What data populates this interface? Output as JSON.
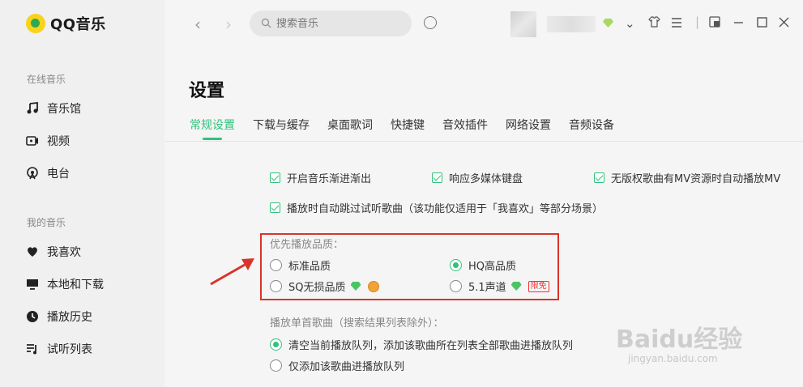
{
  "app": {
    "logo_text": "QQ音乐"
  },
  "sidebar": {
    "online_label": "在线音乐",
    "online_items": [
      {
        "label": "音乐馆",
        "icon": "music-note-icon"
      },
      {
        "label": "视频",
        "icon": "video-icon"
      },
      {
        "label": "电台",
        "icon": "radio-icon"
      }
    ],
    "mine_label": "我的音乐",
    "mine_items": [
      {
        "label": "我喜欢",
        "icon": "heart-icon"
      },
      {
        "label": "本地和下载",
        "icon": "monitor-icon"
      },
      {
        "label": "播放历史",
        "icon": "history-icon"
      },
      {
        "label": "试听列表",
        "icon": "playlist-icon"
      }
    ]
  },
  "topbar": {
    "search_placeholder": "搜索音乐"
  },
  "settings": {
    "title": "设置",
    "tabs": [
      "常规设置",
      "下载与缓存",
      "桌面歌词",
      "快捷键",
      "音效插件",
      "网络设置",
      "音频设备"
    ],
    "active_tab": "常规设置",
    "checkboxes": [
      "开启音乐渐进渐出",
      "响应多媒体键盘",
      "无版权歌曲有MV资源时自动播放MV",
      "播放时自动跳过试听歌曲（该功能仅适用于「我喜欢」等部分场景）"
    ],
    "quality": {
      "label": "优先播放品质：",
      "options": [
        "标准品质",
        "HQ高品质",
        "SQ无损品质",
        "5.1声道"
      ],
      "selected": "HQ高品质",
      "free_badge": "限免"
    },
    "single_play": {
      "label": "播放单首歌曲（搜索结果列表除外）：",
      "options": [
        "清空当前播放队列，添加该歌曲所在列表全部歌曲进播放队列",
        "仅添加该歌曲进播放队列"
      ],
      "selected": "清空当前播放队列，添加该歌曲所在列表全部歌曲进播放队列"
    }
  },
  "watermark": {
    "brand": "Baidu经验",
    "url": "jingyan.baidu.com"
  },
  "colors": {
    "accent": "#31c27c",
    "highlight": "#d9342b"
  }
}
